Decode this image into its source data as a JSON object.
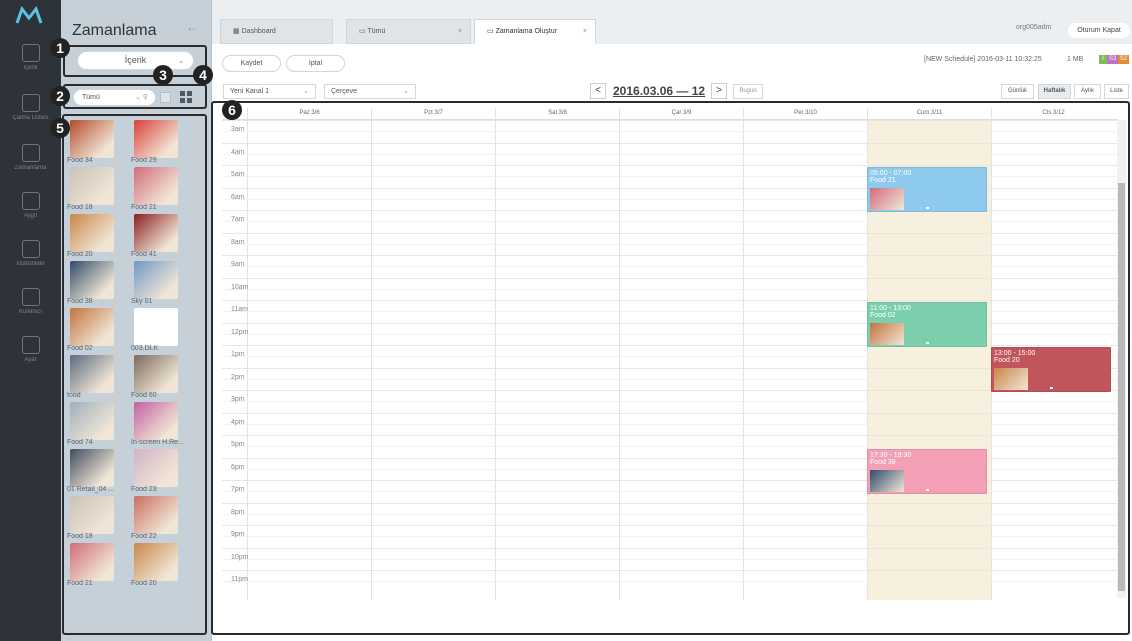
{
  "colors": {
    "rail": "#2e3339",
    "panel": "#c5d0d8",
    "ev_blue": "#8ec9ee",
    "ev_green": "#7ccfad",
    "ev_red": "#c0555c",
    "ev_pink": "#f3a0b6",
    "friday_bg": "#f6f0dc"
  },
  "rail": {
    "logo": "logo-m-icon",
    "items": [
      {
        "label": "İçerik",
        "icon": "grid-icon"
      },
      {
        "label": "Çalma Listesi",
        "icon": "playlist-icon"
      },
      {
        "label": "Zamanlama",
        "icon": "calendar-icon"
      },
      {
        "label": "Aygıt",
        "icon": "monitor-icon"
      },
      {
        "label": "İstatistikler",
        "icon": "bar-chart-icon"
      },
      {
        "label": "Kullanıcı",
        "icon": "user-icon"
      },
      {
        "label": "Ayar",
        "icon": "gear-icon"
      }
    ]
  },
  "panel": {
    "title": "Zamanlama",
    "collapse": "←",
    "content_type": "İçerik",
    "filter": "Tümü",
    "thumbnails": [
      {
        "name": "Food 34",
        "color": "#b54b2a"
      },
      {
        "name": "Food 29",
        "color": "#d9403a"
      },
      {
        "name": "Food 18",
        "color": "#c9c2b6"
      },
      {
        "name": "Food 21",
        "color": "#d06c7b"
      },
      {
        "name": "Food 20",
        "color": "#c98649"
      },
      {
        "name": "Food 41",
        "color": "#8a1f1f"
      },
      {
        "name": "Food 38",
        "color": "#2f4c6a"
      },
      {
        "name": "Sky 01",
        "color": "#6f98c6"
      },
      {
        "name": "Food 02",
        "color": "#c2733d"
      },
      {
        "name": "003.DLK",
        "color": "#ffffff"
      },
      {
        "name": "food",
        "color": "#5a6c80"
      },
      {
        "name": "Food 60",
        "color": "#7b6b5c"
      },
      {
        "name": "Food 74",
        "color": "#9fb0bd"
      },
      {
        "name": "In-screen H.Re...",
        "color": "#c45fa2"
      },
      {
        "name": "01 Retail_04 ...",
        "color": "#3f4d60"
      },
      {
        "name": "Food 23",
        "color": "#d0b3c6"
      },
      {
        "name": "Food 18",
        "color": "#c9c2b6"
      },
      {
        "name": "Food 22",
        "color": "#c96e60"
      },
      {
        "name": "Food 21",
        "color": "#d06c7b"
      },
      {
        "name": "Food 20",
        "color": "#c98649"
      }
    ]
  },
  "tabs": [
    {
      "label": "Dashboard",
      "icon": "dashboard-icon",
      "closable": false
    },
    {
      "label": "Tümü",
      "icon": "calendar-icon",
      "closable": true
    },
    {
      "label": "Zamanlama Oluştur",
      "icon": "calendar-icon",
      "closable": true
    }
  ],
  "header": {
    "user": "org005adm",
    "logout": "Oturum Kapat",
    "close": "×"
  },
  "toolbar": {
    "save": "Kaydet",
    "cancel": "İptal",
    "meta": "[NEW Schedule] 2016-03-11 10:32:25",
    "size": "1 MB",
    "color_badges": [
      "I",
      "S3",
      "S2"
    ],
    "channel": "Yeni Kanal 1",
    "frame": "Çerçeve",
    "prev": "<",
    "next": ">",
    "range": "2016.03.06 — 12",
    "today": "Bugün",
    "views": [
      "Günlük",
      "Haftalık",
      "Aylık",
      "Liste"
    ],
    "active_view": "Haftalık"
  },
  "calendar": {
    "days": [
      "Paz 3/6",
      "Pzt 3/7",
      "Sal 3/8",
      "Çar 3/9",
      "Per 3/10",
      "Cum 3/11",
      "Cts 3/12"
    ],
    "hours": [
      "3am",
      "4am",
      "5am",
      "6am",
      "7am",
      "8am",
      "9am",
      "10am",
      "11am",
      "12pm",
      "1pm",
      "2pm",
      "3pm",
      "4pm",
      "5pm",
      "6pm",
      "7pm",
      "8pm",
      "9pm",
      "10pm",
      "11pm"
    ],
    "events": [
      {
        "day": 5,
        "start": 5,
        "end": 7,
        "time": "05:00 - 07:00",
        "name": "Food 21",
        "color": "#8ec9ee",
        "thumb": "#d06c7b"
      },
      {
        "day": 5,
        "start": 11,
        "end": 13,
        "time": "11:00 - 13:00",
        "name": "Food 02",
        "color": "#7ccfad",
        "thumb": "#c2733d"
      },
      {
        "day": 6,
        "start": 13,
        "end": 15,
        "time": "13:00 - 15:00",
        "name": "Food 20",
        "color": "#c0555c",
        "thumb": "#c98649"
      },
      {
        "day": 5,
        "start": 17.5,
        "end": 19.5,
        "time": "17:30 - 19:30",
        "name": "Food 38",
        "color": "#f3a0b6",
        "thumb": "#2f4c6a"
      }
    ]
  },
  "callouts": [
    "1",
    "2",
    "3",
    "4",
    "5",
    "6"
  ]
}
